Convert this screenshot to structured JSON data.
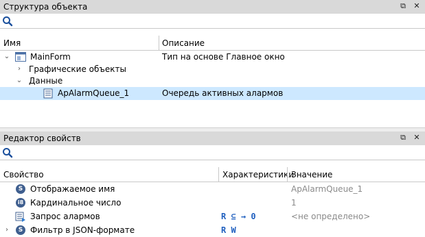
{
  "structure_panel": {
    "title": "Структура объекта",
    "pin_icon": "pin-icon",
    "close_icon": "close-icon",
    "search_placeholder": "",
    "columns": {
      "name": "Имя",
      "description": "Описание"
    },
    "tree": {
      "root": {
        "label": "MainForm",
        "description": "Тип на основе Главное окно"
      },
      "graphic_objects": {
        "label": "Графические объекты"
      },
      "data": {
        "label": "Данные"
      },
      "alarm_queue": {
        "label": "ApAlarmQueue_1",
        "description": "Очередь активных алармов"
      }
    }
  },
  "properties_panel": {
    "title": "Редактор свойств",
    "search_placeholder": "",
    "columns": {
      "property": "Свойство",
      "characteristics": "Характеристики",
      "value": "Значение"
    },
    "rows": [
      {
        "badge": "S",
        "name": "Отображаемое имя",
        "characteristics": "",
        "value": "ApAlarmQueue_1"
      },
      {
        "badge": "i8",
        "name": "Кардинальное число",
        "characteristics": "",
        "value": "1"
      },
      {
        "badge": "",
        "name": "Запрос алармов",
        "characteristics": "R ⊆ → 0",
        "value": "<не определено>"
      },
      {
        "badge": "S",
        "name": "Фильтр в JSON-формате",
        "characteristics": "R W",
        "value": ""
      }
    ]
  },
  "colors": {
    "header_bg": "#d9d9d9",
    "selection": "#cde8ff",
    "badge": "#3f5f8f",
    "accent": "#1f5fbf"
  }
}
